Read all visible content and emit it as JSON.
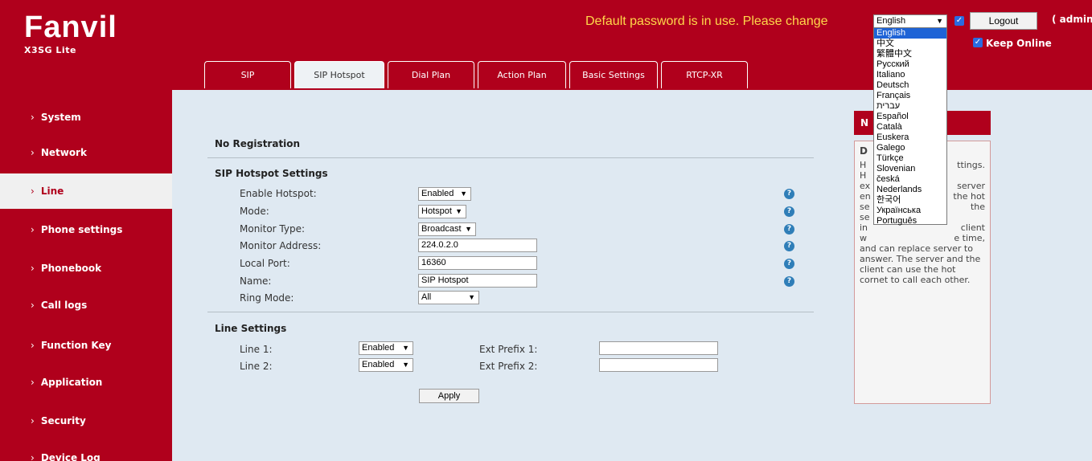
{
  "header": {
    "brand": "Fanvil",
    "model": "X3SG Lite",
    "warning": "Default password is in use. Please change",
    "logout_label": "Logout",
    "user": "( admin",
    "keep_online_label": "Keep Online"
  },
  "language": {
    "selected": "English",
    "options": [
      "English",
      "中文",
      "繁體中文",
      "Русский",
      "Italiano",
      "Deutsch",
      "Français",
      "עברית",
      "Español",
      "Català",
      "Euskera",
      "Galego",
      "Türkçe",
      "Slovenian",
      "česká",
      "Nederlands",
      "한국어",
      "Українська",
      "Português"
    ]
  },
  "sidebar": {
    "items": [
      {
        "label": "System"
      },
      {
        "label": "Network"
      },
      {
        "label": "Line"
      },
      {
        "label": "Phone settings"
      },
      {
        "label": "Phonebook"
      },
      {
        "label": "Call logs"
      },
      {
        "label": "Function Key"
      },
      {
        "label": "Application"
      },
      {
        "label": "Security"
      },
      {
        "label": "Device Log"
      }
    ],
    "active": "Line"
  },
  "tabs": [
    {
      "label": "SIP"
    },
    {
      "label": "SIP Hotspot"
    },
    {
      "label": "Dial Plan"
    },
    {
      "label": "Action Plan"
    },
    {
      "label": "Basic Settings"
    },
    {
      "label": "RTCP-XR"
    }
  ],
  "main": {
    "registration_status": "No Registration",
    "hotspot_title": "SIP Hotspot Settings",
    "fields": {
      "enable_hotspot": {
        "label": "Enable Hotspot:",
        "value": "Enabled"
      },
      "mode": {
        "label": "Mode:",
        "value": "Hotspot"
      },
      "monitor_type": {
        "label": "Monitor Type:",
        "value": "Broadcast"
      },
      "monitor_address": {
        "label": "Monitor Address:",
        "value": "224.0.2.0"
      },
      "local_port": {
        "label": "Local Port:",
        "value": "16360"
      },
      "name": {
        "label": "Name:",
        "value": "SIP Hotspot"
      },
      "ring_mode": {
        "label": "Ring Mode:",
        "value": "All"
      }
    },
    "line_title": "Line Settings",
    "lines": [
      {
        "label": "Line 1:",
        "value": "Enabled",
        "prefix_label": "Ext Prefix 1:",
        "prefix_value": ""
      },
      {
        "label": "Line 2:",
        "value": "Enabled",
        "prefix_label": "Ext Prefix 2:",
        "prefix_value": ""
      }
    ],
    "apply_label": "Apply"
  },
  "note": {
    "head_fragment": "N",
    "title_fragment": "D",
    "lines": [
      [
        "H",
        "ttings."
      ],
      [
        "H",
        ""
      ],
      [
        "ex",
        "server"
      ],
      [
        "en",
        "the hot"
      ],
      [
        "se",
        "the"
      ],
      [
        "se",
        ""
      ],
      [
        "in",
        "client"
      ],
      [
        "w",
        "e time,"
      ]
    ],
    "rest": "and can replace server to answer. The server and the client can use the hot cornet to call each other."
  },
  "colors": {
    "brand_red": "#b0001c",
    "warning_yellow": "#ffd84a",
    "content_bg": "#dfe9f2"
  }
}
